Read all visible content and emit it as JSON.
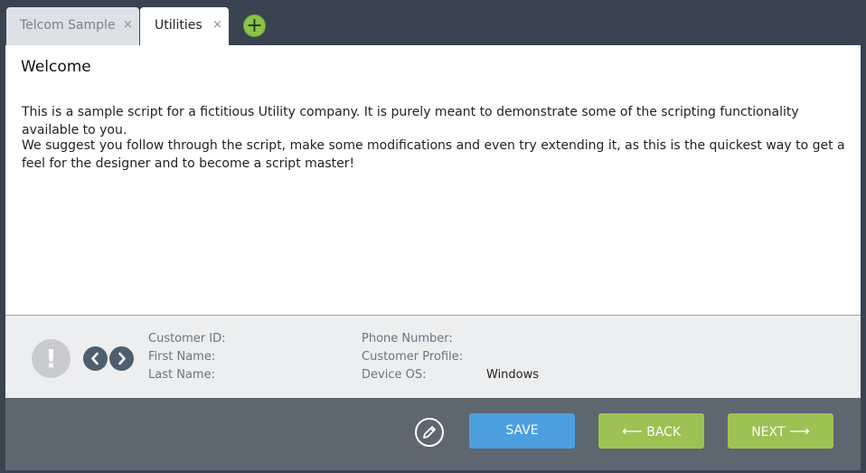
{
  "tabs": [
    {
      "label": "Telcom Sample",
      "close": "×",
      "active": false
    },
    {
      "label": "Utilities",
      "close": "×",
      "active": true
    }
  ],
  "add_tab": {
    "label": "+",
    "icon": "plus-circle-icon",
    "color": "#8bc34a"
  },
  "page": {
    "title": "Welcome",
    "paragraphs": [
      "This is a sample script for a fictitious Utility company. It is purely meant to demonstrate some of the scripting functionality available to you.",
      "We suggest you follow through the script, make some modifications and even try extending it, as this is the quickest way to get a feel for the designer and to become a script master!"
    ]
  },
  "info": {
    "alert_icon": "!",
    "fields_left": [
      {
        "label": "Customer ID:",
        "value": ""
      },
      {
        "label": "First Name:",
        "value": ""
      },
      {
        "label": "Last Name:",
        "value": ""
      }
    ],
    "fields_right": [
      {
        "label": "Phone Number:",
        "value": ""
      },
      {
        "label": "Customer Profile:",
        "value": ""
      },
      {
        "label": "Device OS:",
        "value": "Windows"
      }
    ]
  },
  "actions": {
    "save_label": "SAVE",
    "back_label": "BACK",
    "next_label": "NEXT",
    "back_arrow": "⟵",
    "next_arrow": "⟶",
    "save_color": "#4c9fde",
    "nav_color": "#9dc152"
  }
}
